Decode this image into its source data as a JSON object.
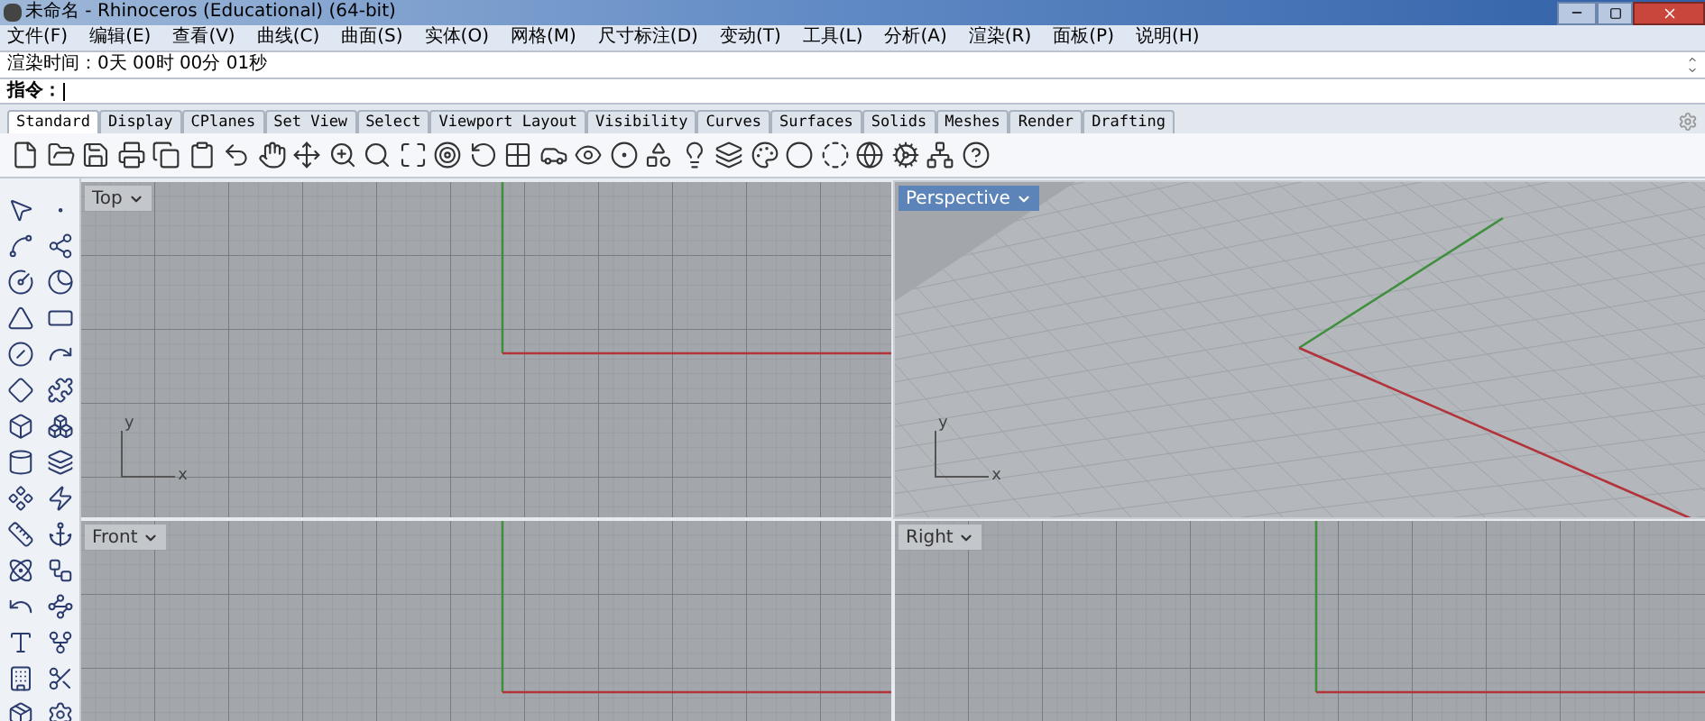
{
  "window": {
    "title": "未命名 - Rhinoceros (Educational) (64-bit)"
  },
  "menu": [
    "文件(F)",
    "编辑(E)",
    "查看(V)",
    "曲线(C)",
    "曲面(S)",
    "实体(O)",
    "网格(M)",
    "尺寸标注(D)",
    "变动(T)",
    "工具(L)",
    "分析(A)",
    "渲染(R)",
    "面板(P)",
    "说明(H)"
  ],
  "history": {
    "text": "渲染时间：0天 00时 00分 01秒"
  },
  "command": {
    "label": "指令："
  },
  "tabs": [
    {
      "label": "Standard",
      "selected": true
    },
    {
      "label": "Display",
      "selected": false
    },
    {
      "label": "CPlanes",
      "selected": false
    },
    {
      "label": "Set View",
      "selected": false
    },
    {
      "label": "Select",
      "selected": false
    },
    {
      "label": "Viewport Layout",
      "selected": false
    },
    {
      "label": "Visibility",
      "selected": false
    },
    {
      "label": "Curves",
      "selected": false
    },
    {
      "label": "Surfaces",
      "selected": false
    },
    {
      "label": "Solids",
      "selected": false
    },
    {
      "label": "Meshes",
      "selected": false
    },
    {
      "label": "Render",
      "selected": false
    },
    {
      "label": "Drafting",
      "selected": false
    }
  ],
  "viewports": [
    {
      "title": "Top",
      "kind": "plan",
      "selected": false,
      "axis_labels": [
        "y",
        "x"
      ]
    },
    {
      "title": "Perspective",
      "kind": "perspective",
      "selected": true,
      "axis_labels": [
        "y",
        "x"
      ]
    },
    {
      "title": "Front",
      "kind": "plan",
      "selected": false
    },
    {
      "title": "Right",
      "kind": "plan",
      "selected": false
    }
  ]
}
